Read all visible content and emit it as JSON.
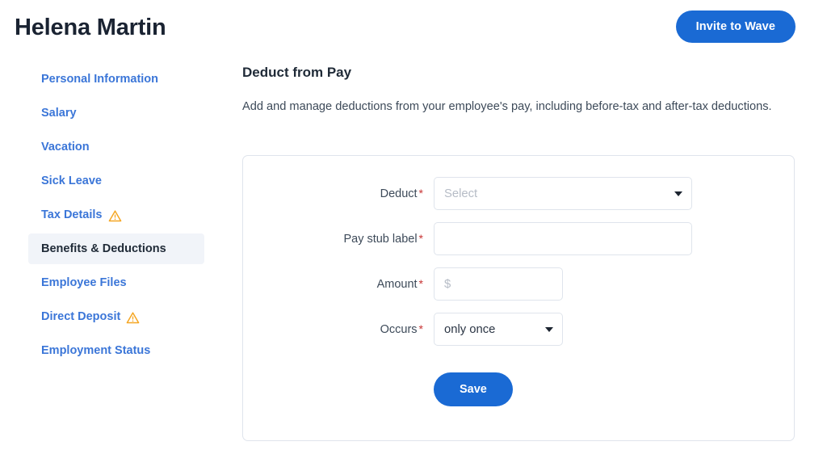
{
  "header": {
    "employee_name": "Helena Martin",
    "invite_button_label": "Invite to Wave"
  },
  "sidebar": {
    "items": [
      {
        "label": "Personal Information",
        "active": false,
        "warning": false
      },
      {
        "label": "Salary",
        "active": false,
        "warning": false
      },
      {
        "label": "Vacation",
        "active": false,
        "warning": false
      },
      {
        "label": "Sick Leave",
        "active": false,
        "warning": false
      },
      {
        "label": "Tax Details",
        "active": false,
        "warning": true
      },
      {
        "label": "Benefits & Deductions",
        "active": true,
        "warning": false
      },
      {
        "label": "Employee Files",
        "active": false,
        "warning": false
      },
      {
        "label": "Direct Deposit",
        "active": false,
        "warning": true
      },
      {
        "label": "Employment Status",
        "active": false,
        "warning": false
      }
    ]
  },
  "main": {
    "section_title": "Deduct from Pay",
    "section_description": "Add and manage deductions from your employee's pay, including before-tax and after-tax deductions."
  },
  "form": {
    "required_marker": "*",
    "fields": {
      "deduct": {
        "label": "Deduct",
        "type": "select",
        "value": "Select",
        "is_placeholder": true
      },
      "pay_stub_label": {
        "label": "Pay stub label",
        "type": "text",
        "value": "",
        "placeholder": ""
      },
      "amount": {
        "label": "Amount",
        "type": "text",
        "value": "",
        "placeholder": "$"
      },
      "occurs": {
        "label": "Occurs",
        "type": "select",
        "value": "only once",
        "is_placeholder": false
      }
    },
    "save_button_label": "Save"
  },
  "colors": {
    "link_blue": "#3b76d8",
    "button_blue": "#1a6ad4",
    "warning_orange": "#f5a623",
    "required_red": "#c83434",
    "active_bg": "#f1f4f9",
    "border": "#dfe4ec"
  }
}
